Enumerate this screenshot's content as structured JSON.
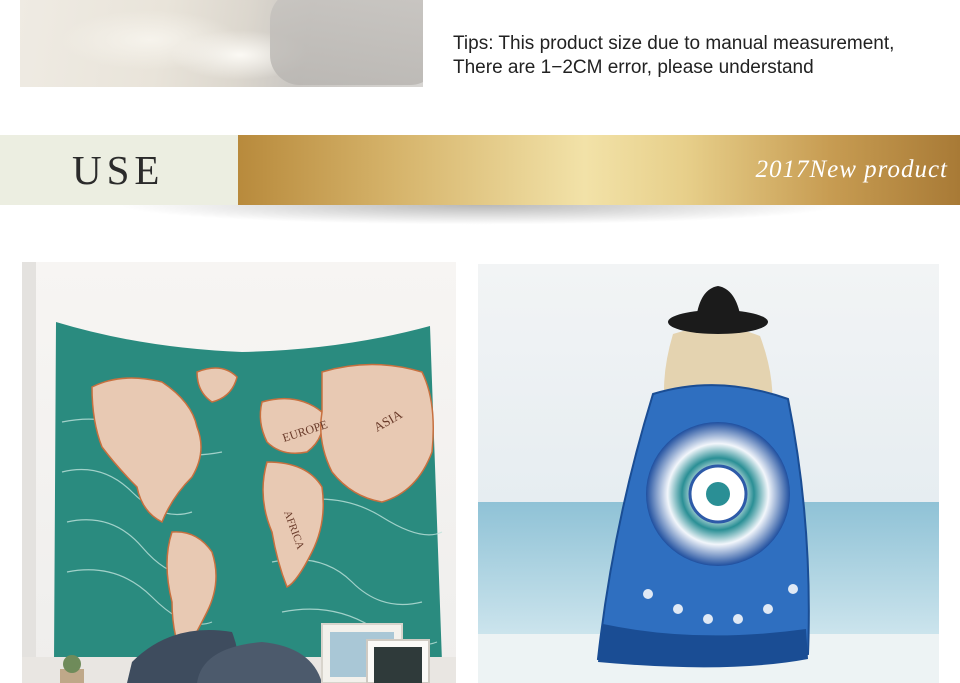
{
  "tips": {
    "line1": "Tips: This product size due to manual measurement,",
    "line2": "There are 1−2CM error, please understand"
  },
  "banner": {
    "title": "USE",
    "subtitle": "2017New product",
    "accent_colors": {
      "left_panel": "#eceee1",
      "gold_mid": "#f2e2a8",
      "gold_edge": "#b88a3c"
    }
  },
  "photos": {
    "left": {
      "labels": [
        "EUROPE",
        "ASIA",
        "AFRICA"
      ]
    },
    "right": {}
  }
}
